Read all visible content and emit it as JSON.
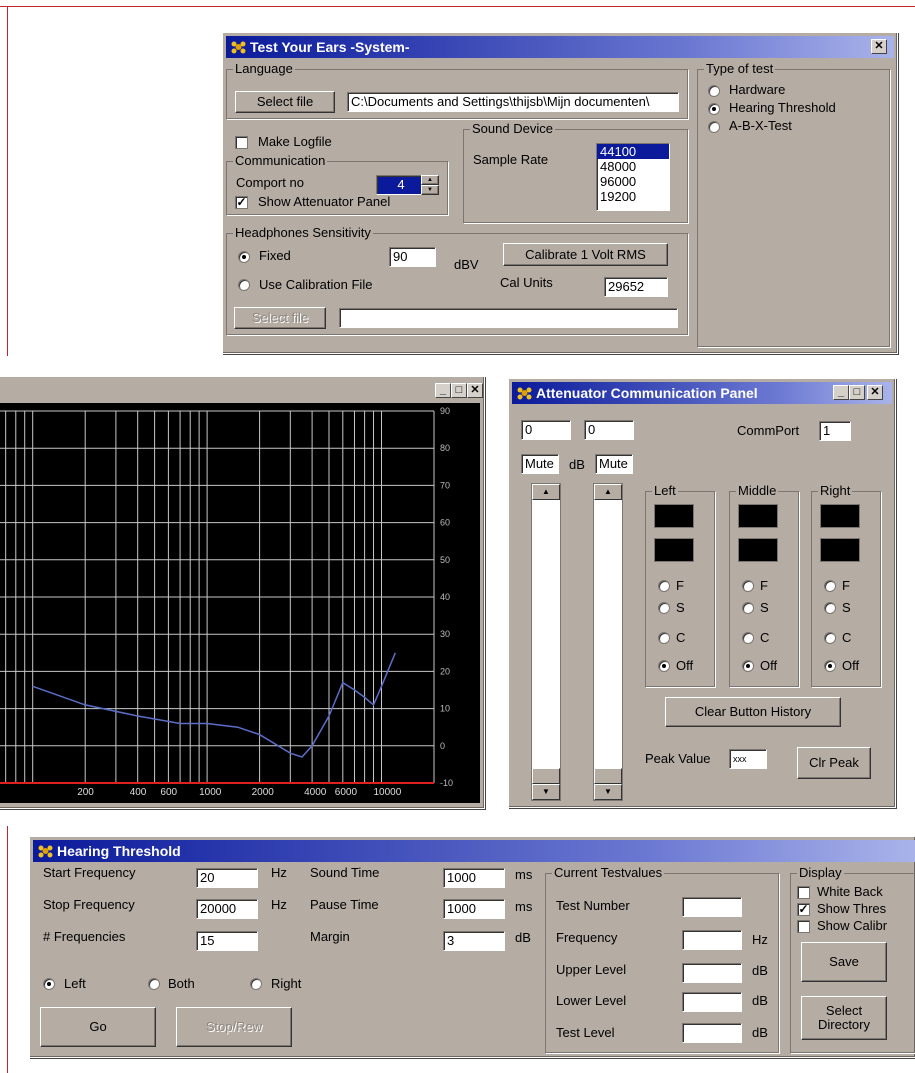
{
  "system_window": {
    "title": "Test Your Ears -System-",
    "close_icon": "close-icon",
    "language": {
      "group_label": "Language",
      "select_file_label": "Select file",
      "path_value": "C:\\Documents and Settings\\thijsb\\Mijn documenten\\"
    },
    "make_logfile_label": "Make Logfile",
    "make_logfile_checked": false,
    "communication": {
      "group_label": "Communication",
      "comport_label": "Comport no",
      "comport_value": "4",
      "show_attenuator_label": "Show Attenuator Panel",
      "show_attenuator_checked": true
    },
    "sound_device": {
      "group_label": "Sound Device",
      "sample_rate_label": "Sample Rate",
      "sample_rates": [
        "44100",
        "48000",
        "96000",
        "19200"
      ],
      "selected_rate": "44100"
    },
    "headphones": {
      "group_label": "Headphones Sensitivity",
      "fixed_label": "Fixed",
      "fixed_value": "90",
      "unit_label": "dBV",
      "calibrate_label": "Calibrate 1 Volt RMS",
      "use_cal_file_label": "Use Calibration File",
      "cal_units_label": "Cal Units",
      "cal_units_value": "29652",
      "select_file_label": "Select file",
      "selected_option": "Fixed"
    },
    "type_of_test": {
      "group_label": "Type of test",
      "options": [
        "Hardware",
        "Hearing Threshold",
        "A-B-X-Test"
      ],
      "selected": "Hearing Threshold"
    }
  },
  "graph_window": {
    "controls": [
      "_",
      "□",
      "x"
    ],
    "background": "#000000",
    "grid_color": "#c8c8c8",
    "line_color": "#5a6ec8",
    "baseline_color": "#e02020"
  },
  "chart_data": {
    "type": "line",
    "xscale": "log",
    "x_tick_labels": [
      "200",
      "400",
      "600",
      "1000",
      "2000",
      "4000",
      "6000",
      "10000"
    ],
    "y_tick_labels": [
      "90",
      "80",
      "70",
      "60",
      "50",
      "40",
      "30",
      "20",
      "10",
      "0",
      "-10"
    ],
    "ylim": [
      -10,
      90
    ],
    "series": [
      {
        "x": [
          100,
          200,
          400,
          700,
          1000,
          1500,
          2000,
          3000,
          3500,
          4000,
          5000,
          6000,
          7000,
          8000,
          9000,
          10000,
          12000
        ],
        "values": [
          16,
          11,
          8,
          6,
          6,
          5,
          3,
          -2,
          -3,
          0,
          8,
          17,
          15,
          13,
          11,
          16,
          25
        ]
      }
    ]
  },
  "attenuator_window": {
    "title": "Attenuator Communication Panel",
    "controls": [
      "_",
      "□",
      "x"
    ],
    "left_value": "0",
    "right_value": "0",
    "left_mute": "Mute",
    "right_mute": "Mute",
    "db_label": "dB",
    "commport_label": "CommPort",
    "commport_value": "1",
    "groups": [
      {
        "label": "Left"
      },
      {
        "label": "Middle"
      },
      {
        "label": "Right"
      }
    ],
    "radio_options": [
      "F",
      "S",
      "C",
      "Off"
    ],
    "selected_option": "Off",
    "clear_history_label": "Clear  Button  History",
    "peak_value_label": "Peak Value",
    "peak_value": "xxx",
    "clr_peak_label": "Clr Peak"
  },
  "hearing_window": {
    "title": "Hearing Threshold",
    "start_freq_label": "Start Frequency",
    "start_freq_value": "20",
    "stop_freq_label": "Stop Frequency",
    "stop_freq_value": "20000",
    "num_freq_label": "# Frequencies",
    "num_freq_value": "15",
    "hz_label": "Hz",
    "sound_time_label": "Sound Time",
    "sound_time_value": "1000",
    "pause_time_label": "Pause Time",
    "pause_time_value": "1000",
    "margin_label": "Margin",
    "margin_value": "3",
    "ms_label": "ms",
    "db_label": "dB",
    "ear_options": [
      "Left",
      "Both",
      "Right"
    ],
    "selected_ear": "Left",
    "go_label": "Go",
    "stop_label": "Stop/Rew",
    "current": {
      "group_label": "Current Testvalues",
      "test_number_label": "Test Number",
      "frequency_label": "Frequency",
      "upper_level_label": "Upper Level",
      "lower_level_label": "Lower Level",
      "test_level_label": "Test Level",
      "hz_label": "Hz",
      "db_label": "dB"
    },
    "display": {
      "group_label": "Display",
      "options": [
        "White Back",
        "Show Thres",
        "Show Calibr"
      ],
      "checked": [
        false,
        true,
        false
      ],
      "save_label": "Save",
      "select_dir_line1": "Select",
      "select_dir_line2": "Directory"
    }
  }
}
